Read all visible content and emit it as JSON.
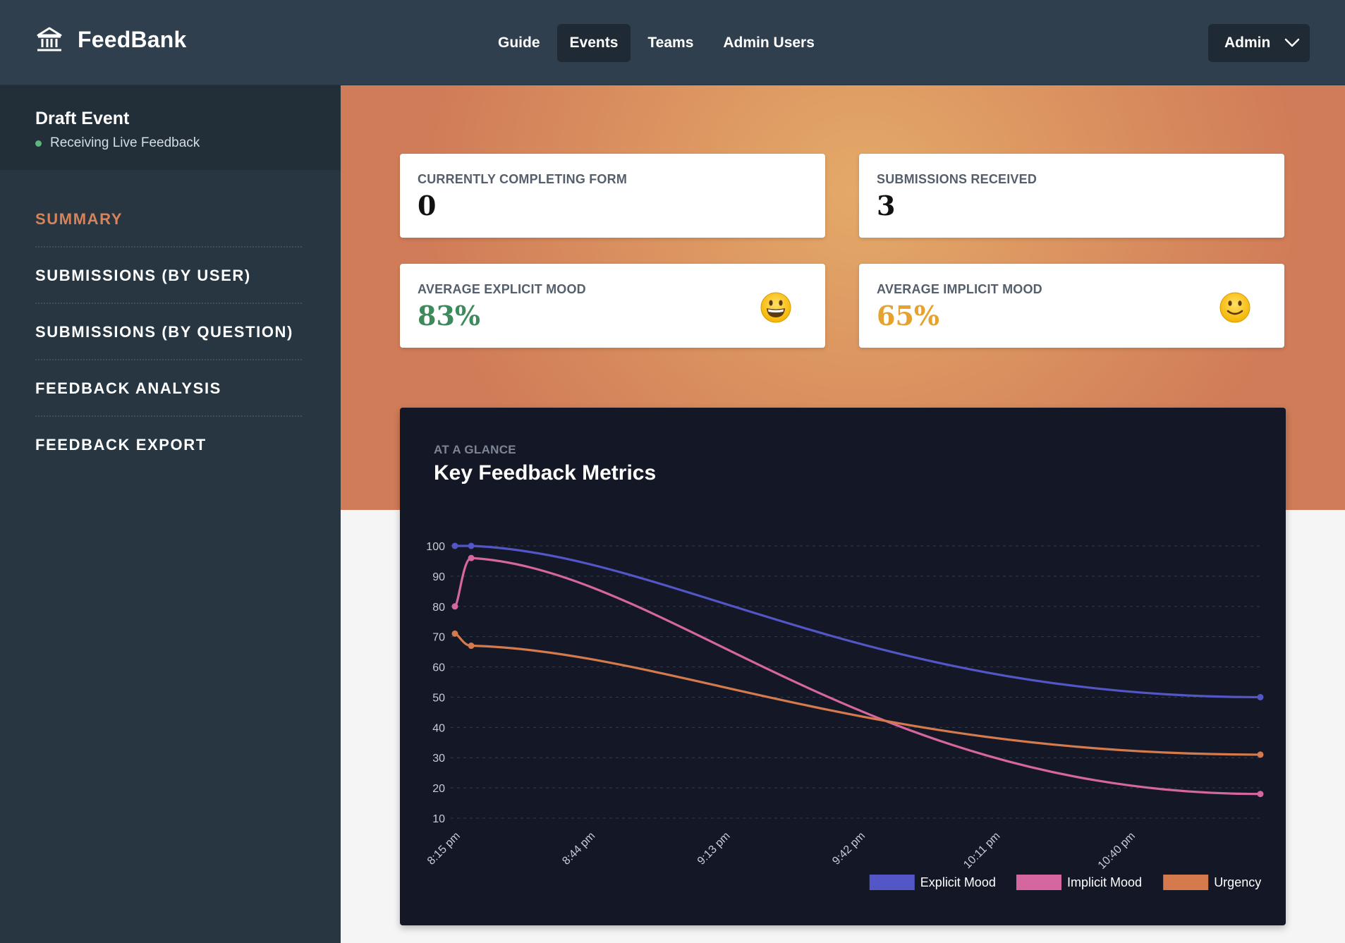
{
  "app": {
    "name": "FeedBank"
  },
  "nav": {
    "items": [
      "Guide",
      "Events",
      "Teams",
      "Admin Users"
    ],
    "active": "Events"
  },
  "user_menu": {
    "label": "Admin"
  },
  "event": {
    "title": "Draft Event",
    "status": "Receiving Live Feedback",
    "status_color": "#5cb67e"
  },
  "sidebar": {
    "items": [
      {
        "label": "SUMMARY",
        "active": true
      },
      {
        "label": "SUBMISSIONS (BY USER)",
        "active": false
      },
      {
        "label": "SUBMISSIONS (BY QUESTION)",
        "active": false
      },
      {
        "label": "FEEDBACK ANALYSIS",
        "active": false
      },
      {
        "label": "FEEDBACK EXPORT",
        "active": false
      }
    ]
  },
  "stats": {
    "completing": {
      "label": "CURRENTLY COMPLETING FORM",
      "value": "0"
    },
    "submissions": {
      "label": "SUBMISSIONS RECEIVED",
      "value": "3"
    },
    "explicit": {
      "label": "AVERAGE EXPLICIT MOOD",
      "value": "83%",
      "icon": "grinning-face-icon",
      "color": "#3f8a5d"
    },
    "implicit": {
      "label": "AVERAGE IMPLICIT MOOD",
      "value": "65%",
      "icon": "slightly-smiling-face-icon",
      "color": "#e5a22f"
    }
  },
  "chart_section": {
    "eyebrow": "AT A GLANCE",
    "title": "Key Feedback Metrics"
  },
  "chart_data": {
    "type": "line",
    "title": "Key Feedback Metrics",
    "x_tick_labels": [
      "8:15 pm",
      "8:44 pm",
      "9:13 pm",
      "9:42 pm",
      "10:11 pm",
      "10:40 pm"
    ],
    "x_ticks_minutes_after_8pm": [
      15,
      44,
      73,
      102,
      131,
      160
    ],
    "x_range_minutes_after_8pm": [
      15,
      188
    ],
    "y_ticks": [
      10,
      20,
      30,
      40,
      50,
      60,
      70,
      80,
      90,
      100
    ],
    "ylim": [
      10,
      100
    ],
    "grid": true,
    "legend": "bottom-right",
    "series": [
      {
        "name": "Explicit Mood",
        "color": "#5256c7",
        "x": [
          15,
          18.5,
          188
        ],
        "y": [
          100,
          100,
          50
        ]
      },
      {
        "name": "Implicit Mood",
        "color": "#d5669f",
        "x": [
          15,
          18.5,
          188
        ],
        "y": [
          80,
          96,
          18
        ]
      },
      {
        "name": "Urgency",
        "color": "#d47a4c",
        "x": [
          15,
          18.5,
          188
        ],
        "y": [
          71,
          67,
          31
        ]
      }
    ]
  }
}
